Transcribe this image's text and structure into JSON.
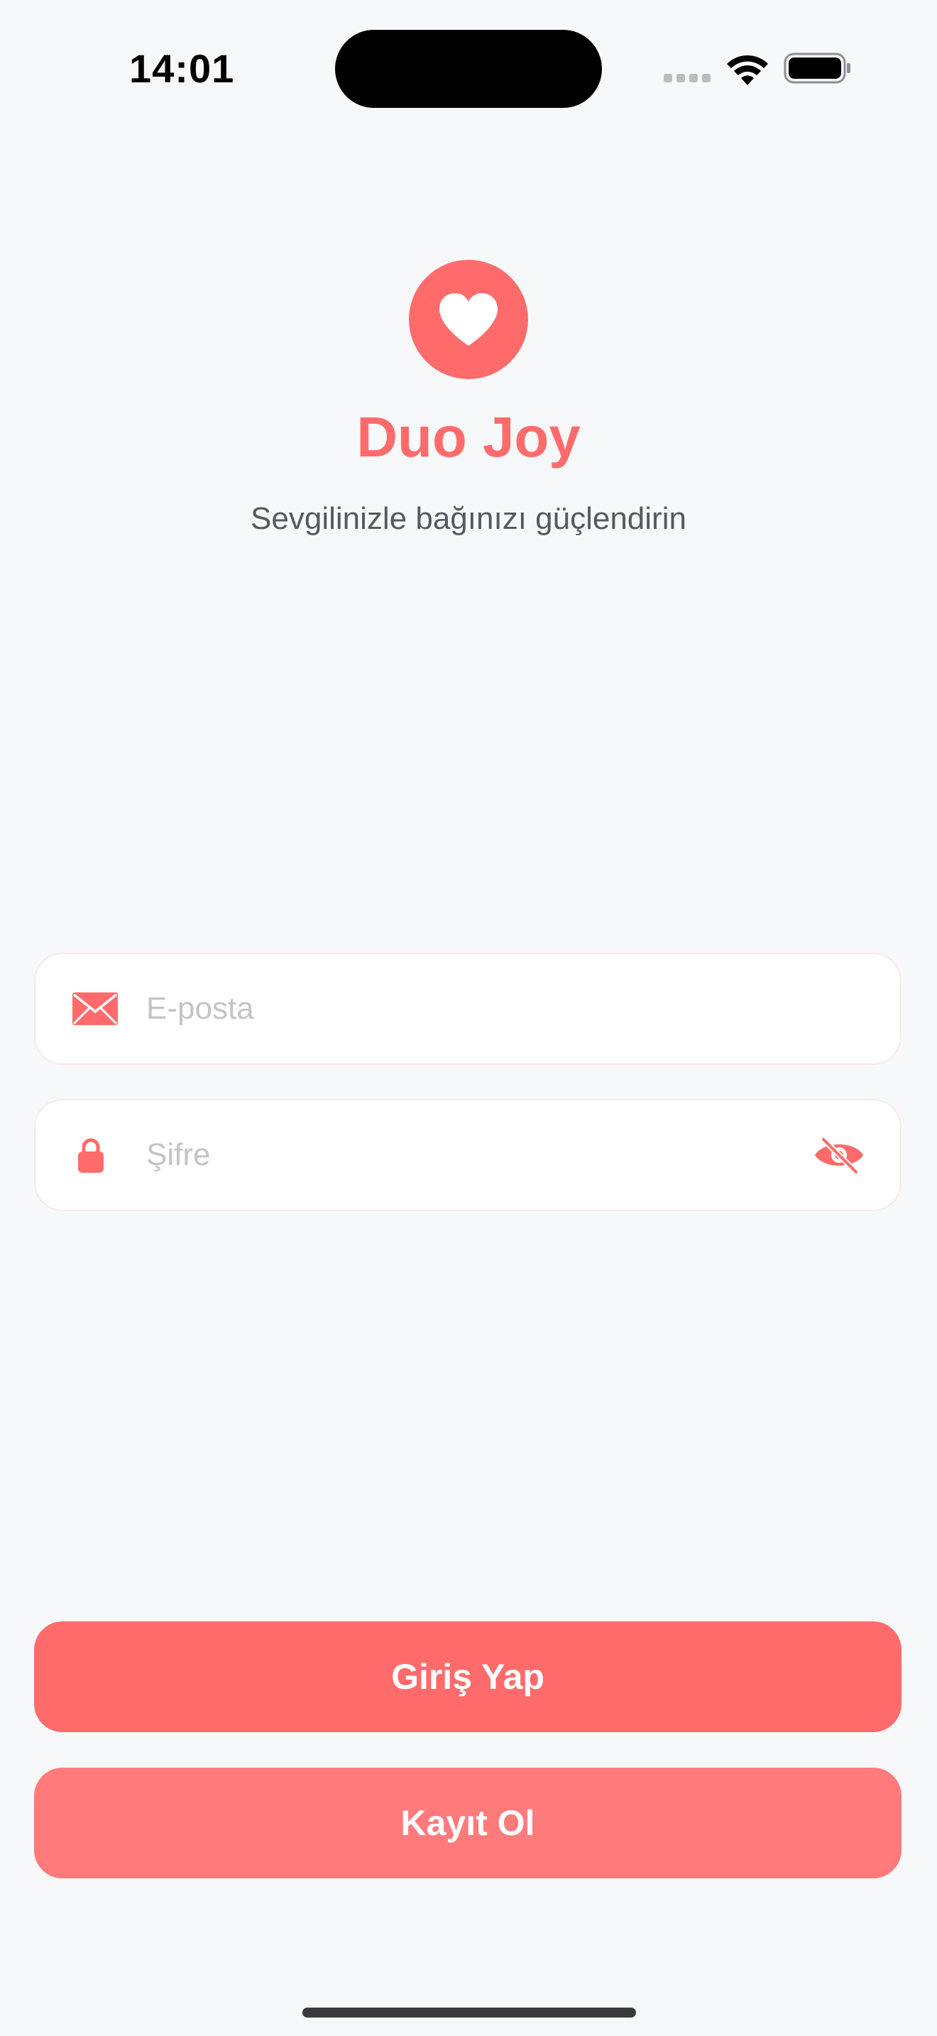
{
  "status_bar": {
    "time": "14:01"
  },
  "brand": {
    "logo_icon": "heart-icon",
    "title": "Duo Joy",
    "subtitle": "Sevgilinizle bağınızı güçlendirin"
  },
  "form": {
    "email": {
      "icon": "envelope-icon",
      "placeholder": "E-posta",
      "value": ""
    },
    "password": {
      "icon": "lock-icon",
      "placeholder": "Şifre",
      "value": "",
      "toggle_icon": "eye-slash-icon"
    }
  },
  "actions": {
    "login_label": "Giriş Yap",
    "register_label": "Kayıt Ol"
  },
  "colors": {
    "accent": "#FF6B6B",
    "accent_light": "#FF7A7A",
    "background": "#F7F8FA",
    "placeholder": "#C4C4C8",
    "subtitle": "#555A60"
  }
}
